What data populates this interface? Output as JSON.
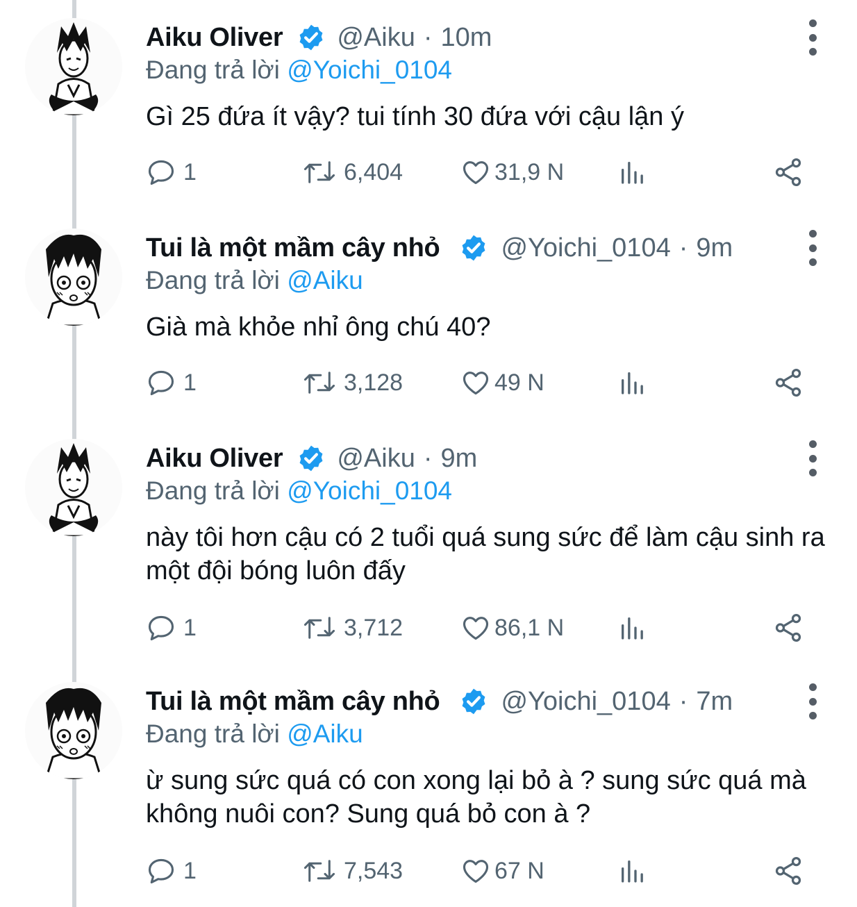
{
  "tweets": [
    {
      "avatar": "avatar-aiku",
      "name": "Aiku Oliver",
      "handle": "@Aiku",
      "dot": "·",
      "time": "10m",
      "replying_prefix": "Đang trả lời ",
      "replying_to": "@Yoichi_0104",
      "text": "Gì 25 đứa ít vậy? tui tính 30 đứa với cậu lận ý",
      "replies": "1",
      "retweets": "6,404",
      "likes": "31,9 N"
    },
    {
      "avatar": "avatar-yoichi",
      "name": "Tui là một mầm cây nhỏ",
      "handle": "@Yoichi_0104",
      "dot": "·",
      "time": "9m",
      "replying_prefix": "Đang trả lời ",
      "replying_to": "@Aiku",
      "text": "Già mà khỏe nhỉ ông chú 40?",
      "replies": "1",
      "retweets": "3,128",
      "likes": "49 N"
    },
    {
      "avatar": "avatar-aiku",
      "name": "Aiku Oliver",
      "handle": "@Aiku",
      "dot": "·",
      "time": "9m",
      "replying_prefix": "Đang trả lời ",
      "replying_to": "@Yoichi_0104",
      "text": "này tôi hơn cậu có 2 tuổi quá sung sức để làm cậu sinh ra một đội bóng luôn đấy",
      "replies": "1",
      "retweets": "3,712",
      "likes": "86,1 N"
    },
    {
      "avatar": "avatar-yoichi",
      "name": "Tui là một mầm cây nhỏ",
      "handle": "@Yoichi_0104",
      "dot": "·",
      "time": "7m",
      "replying_prefix": "Đang trả lời ",
      "replying_to": "@Aiku",
      "text": "ừ sung sức quá có con xong lại bỏ à ? sung sức quá mà không nuôi con? Sung quá bỏ con à ?",
      "replies": "1",
      "retweets": "7,543",
      "likes": "67 N"
    }
  ],
  "colors": {
    "verified": "#1d9bf0",
    "mention": "#1d9bf0",
    "muted": "#536471",
    "thread_line": "#d0d4d8"
  },
  "icons": [
    "reply-icon",
    "retweet-icon",
    "like-icon",
    "views-icon",
    "share-icon",
    "verified-badge-icon",
    "more-options-icon"
  ]
}
